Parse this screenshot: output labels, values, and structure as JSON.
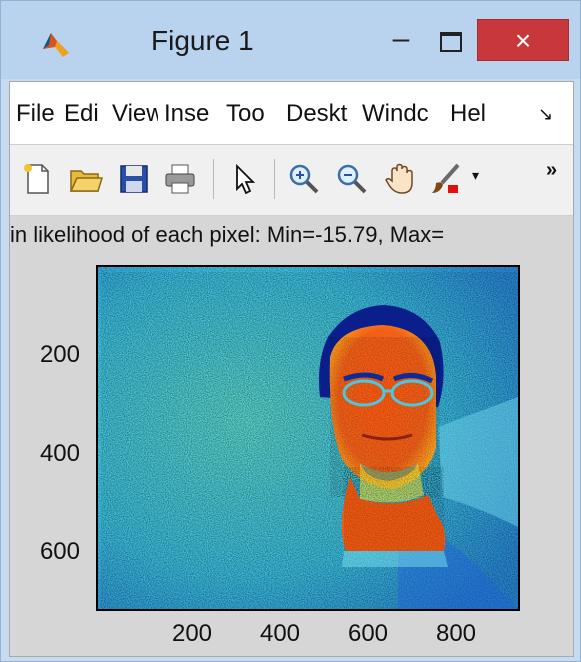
{
  "window": {
    "title": "Figure 1",
    "minimize": "–",
    "close": "×"
  },
  "menu": {
    "items": [
      "File",
      "Edi",
      "View",
      "Inse",
      "Too",
      "Deskt",
      "Windc",
      "Hel",
      "↘"
    ]
  },
  "toolbar": {
    "tools": [
      "new-figure-icon",
      "open-folder-icon",
      "save-icon",
      "print-icon",
      "pointer-icon",
      "zoom-in-icon",
      "zoom-out-icon",
      "pan-hand-icon",
      "brush-icon"
    ],
    "more": "»"
  },
  "plot": {
    "title": "in likelihood of each pixel: Min=-15.79, Max=",
    "yticks": [
      "200",
      "400",
      "600"
    ],
    "xticks": [
      "200",
      "400",
      "600",
      "800"
    ]
  },
  "colors": {
    "titlebar": "#b9d3ee",
    "close": "#c8383a",
    "background": "#d6d6d6"
  }
}
